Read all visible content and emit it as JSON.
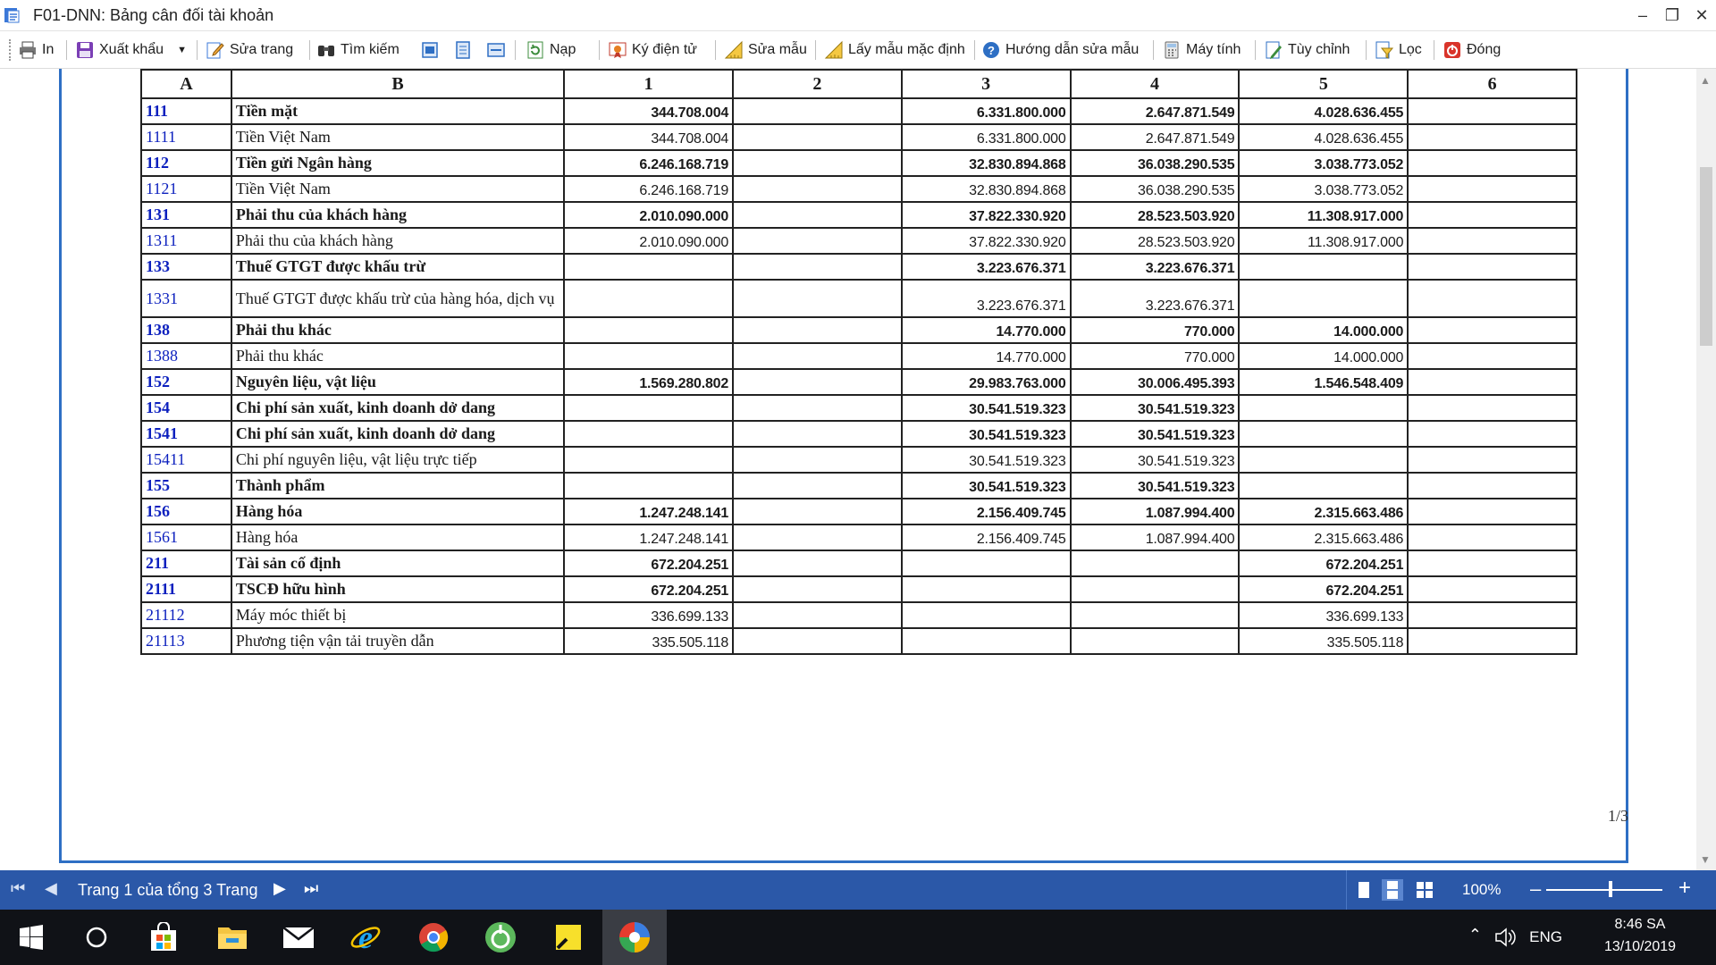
{
  "window": {
    "title": "F01-DNN: Bảng cân đối tài khoản",
    "controls": [
      "–",
      "❐",
      "✕"
    ]
  },
  "toolbar": {
    "print": "In",
    "export": "Xuất khẩu",
    "edit_page": "Sửa trang",
    "search": "Tìm kiếm",
    "reload": "Nạp",
    "e_sign": "Ký điện tử",
    "edit_template": "Sửa mẫu",
    "default_template": "Lấy mẫu mặc định",
    "template_help": "Hướng dẫn sửa mẫu",
    "calculator": "Máy tính",
    "customize": "Tùy chỉnh",
    "filter": "Lọc",
    "close": "Đóng"
  },
  "table": {
    "headers": [
      "A",
      "B",
      "1",
      "2",
      "3",
      "4",
      "5",
      "6"
    ],
    "rows": [
      {
        "code": "111",
        "name": "Tiền mặt",
        "c1": "344.708.004",
        "c2": "",
        "c3": "6.331.800.000",
        "c4": "2.647.871.549",
        "c5": "4.028.636.455",
        "c6": "",
        "bold": true
      },
      {
        "code": "1111",
        "name": "Tiền Việt Nam",
        "c1": "344.708.004",
        "c2": "",
        "c3": "6.331.800.000",
        "c4": "2.647.871.549",
        "c5": "4.028.636.455",
        "c6": "",
        "bold": false
      },
      {
        "code": "112",
        "name": "Tiền gửi Ngân hàng",
        "c1": "6.246.168.719",
        "c2": "",
        "c3": "32.830.894.868",
        "c4": "36.038.290.535",
        "c5": "3.038.773.052",
        "c6": "",
        "bold": true
      },
      {
        "code": "1121",
        "name": "Tiền Việt Nam",
        "c1": "6.246.168.719",
        "c2": "",
        "c3": "32.830.894.868",
        "c4": "36.038.290.535",
        "c5": "3.038.773.052",
        "c6": "",
        "bold": false
      },
      {
        "code": "131",
        "name": "Phải thu của khách hàng",
        "c1": "2.010.090.000",
        "c2": "",
        "c3": "37.822.330.920",
        "c4": "28.523.503.920",
        "c5": "11.308.917.000",
        "c6": "",
        "bold": true
      },
      {
        "code": "1311",
        "name": "Phải thu của khách hàng",
        "c1": "2.010.090.000",
        "c2": "",
        "c3": "37.822.330.920",
        "c4": "28.523.503.920",
        "c5": "11.308.917.000",
        "c6": "",
        "bold": false
      },
      {
        "code": "133",
        "name": "Thuế GTGT được khấu trừ",
        "c1": "",
        "c2": "",
        "c3": "3.223.676.371",
        "c4": "3.223.676.371",
        "c5": "",
        "c6": "",
        "bold": true
      },
      {
        "code": "1331",
        "name": "Thuế GTGT được khấu trừ của hàng hóa, dịch vụ",
        "c1": "",
        "c2": "",
        "c3": "3.223.676.371",
        "c4": "3.223.676.371",
        "c5": "",
        "c6": "",
        "bold": false,
        "tall": true
      },
      {
        "code": "138",
        "name": "Phải thu khác",
        "c1": "",
        "c2": "",
        "c3": "14.770.000",
        "c4": "770.000",
        "c5": "14.000.000",
        "c6": "",
        "bold": true
      },
      {
        "code": "1388",
        "name": "Phải thu khác",
        "c1": "",
        "c2": "",
        "c3": "14.770.000",
        "c4": "770.000",
        "c5": "14.000.000",
        "c6": "",
        "bold": false
      },
      {
        "code": "152",
        "name": "Nguyên liệu, vật liệu",
        "c1": "1.569.280.802",
        "c2": "",
        "c3": "29.983.763.000",
        "c4": "30.006.495.393",
        "c5": "1.546.548.409",
        "c6": "",
        "bold": true
      },
      {
        "code": "154",
        "name": "Chi phí sản xuất, kinh doanh dở dang",
        "c1": "",
        "c2": "",
        "c3": "30.541.519.323",
        "c4": "30.541.519.323",
        "c5": "",
        "c6": "",
        "bold": true
      },
      {
        "code": "1541",
        "name": "Chi phí sản xuất, kinh doanh dở dang",
        "c1": "",
        "c2": "",
        "c3": "30.541.519.323",
        "c4": "30.541.519.323",
        "c5": "",
        "c6": "",
        "bold": true
      },
      {
        "code": "15411",
        "name": "Chi phí nguyên liệu, vật liệu trực tiếp",
        "c1": "",
        "c2": "",
        "c3": "30.541.519.323",
        "c4": "30.541.519.323",
        "c5": "",
        "c6": "",
        "bold": false
      },
      {
        "code": "155",
        "name": "Thành phẩm",
        "c1": "",
        "c2": "",
        "c3": "30.541.519.323",
        "c4": "30.541.519.323",
        "c5": "",
        "c6": "",
        "bold": true
      },
      {
        "code": "156",
        "name": "Hàng hóa",
        "c1": "1.247.248.141",
        "c2": "",
        "c3": "2.156.409.745",
        "c4": "1.087.994.400",
        "c5": "2.315.663.486",
        "c6": "",
        "bold": true
      },
      {
        "code": "1561",
        "name": "Hàng hóa",
        "c1": "1.247.248.141",
        "c2": "",
        "c3": "2.156.409.745",
        "c4": "1.087.994.400",
        "c5": "2.315.663.486",
        "c6": "",
        "bold": false
      },
      {
        "code": "211",
        "name": "Tài sản cố định",
        "c1": "672.204.251",
        "c2": "",
        "c3": "",
        "c4": "",
        "c5": "672.204.251",
        "c6": "",
        "bold": true
      },
      {
        "code": "2111",
        "name": "TSCĐ hữu hình",
        "c1": "672.204.251",
        "c2": "",
        "c3": "",
        "c4": "",
        "c5": "672.204.251",
        "c6": "",
        "bold": true
      },
      {
        "code": "21112",
        "name": "Máy móc thiết bị",
        "c1": "336.699.133",
        "c2": "",
        "c3": "",
        "c4": "",
        "c5": "336.699.133",
        "c6": "",
        "bold": false
      },
      {
        "code": "21113",
        "name": "Phương tiện vận tải truyền dẫn",
        "c1": "335.505.118",
        "c2": "",
        "c3": "",
        "c4": "",
        "c5": "335.505.118",
        "c6": "",
        "bold": false
      }
    ]
  },
  "page_number": "1/3",
  "statusbar": {
    "page_info": "Trang 1 của tổng 3 Trang",
    "zoom": "100%",
    "zoom_minus": "–",
    "zoom_plus": "+"
  },
  "taskbar": {
    "time": "8:46 SA",
    "date": "13/10/2019",
    "lang": "ENG"
  },
  "colors": {
    "code_blue": "#0b1fbe",
    "status_bar": "#2b58a8",
    "page_border": "#2e6fc4"
  }
}
